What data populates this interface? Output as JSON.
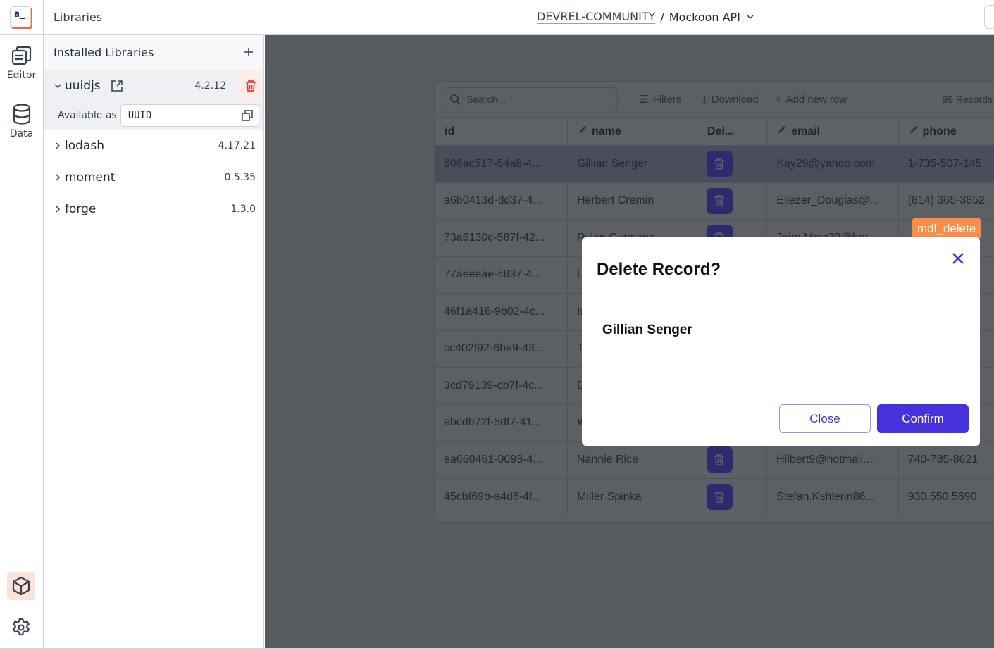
{
  "header": {
    "logo_text": "a_",
    "title": "Libraries",
    "org": "DEVREL-COMMUNITY",
    "separator": "/",
    "project": "Mockoon API"
  },
  "rail": {
    "items": [
      {
        "label": "Editor",
        "icon": "editor-icon"
      },
      {
        "label": "Data",
        "icon": "database-icon"
      }
    ],
    "bottom": [
      {
        "icon": "package-icon",
        "selected": true
      },
      {
        "icon": "gear-icon"
      }
    ]
  },
  "libraries": {
    "title": "Installed Libraries",
    "items": [
      {
        "name": "uuidjs",
        "version": "4.2.12",
        "expanded": true,
        "available_as_label": "Available as",
        "available_as": "UUID"
      },
      {
        "name": "lodash",
        "version": "4.17.21"
      },
      {
        "name": "moment",
        "version": "0.5.35"
      },
      {
        "name": "forge",
        "version": "1.3.0"
      }
    ]
  },
  "table": {
    "search_placeholder": "Search...",
    "filters": "Filters",
    "download": "Download",
    "add_row": "Add new row",
    "records": "99 Records",
    "columns": [
      "id",
      "name",
      "Del...",
      "email",
      "phone"
    ],
    "rows": [
      [
        "606ac517-54a8-4...",
        "Gillian Senger",
        "",
        "Kay29@yahoo.com",
        "1-735-507-145"
      ],
      [
        "a6b0413d-dd37-4...",
        "Herbert Cremin",
        "",
        "Eliezer_Douglas@...",
        "(814) 365-3852"
      ],
      [
        "73a6130c-587f-42...",
        "Rylan Gutmann",
        "",
        "Jairo.Metz32@hot...",
        ""
      ],
      [
        "77aeeeae-c837-4...",
        "L",
        "",
        "",
        ""
      ],
      [
        "46f1a416-9b02-4c...",
        "Is",
        "",
        "",
        ""
      ],
      [
        "cc402f92-6be9-43...",
        "T",
        "",
        "",
        ""
      ],
      [
        "3cd79139-cb7f-4c...",
        "D",
        "",
        "",
        ""
      ],
      [
        "ebcdb72f-5df7-41...",
        "W",
        "",
        "",
        ""
      ],
      [
        "ea660461-0093-4...",
        "Nannie Rice",
        "",
        "Hilbert9@hotmail....",
        "740-785-8621"
      ],
      [
        "45cbf69b-a4d8-4f...",
        "Miller Spinka",
        "",
        "Stefan.Kshlerin86...",
        "930.550.5690"
      ]
    ]
  },
  "tag": "mdl_delete",
  "modal": {
    "title": "Delete Record?",
    "record_name": "Gillian Senger",
    "close": "Close",
    "confirm": "Confirm"
  },
  "colors": {
    "accent": "#4631dc",
    "brand": "#f06a35",
    "tag": "#fa8c4a",
    "danger": "#e53935"
  }
}
